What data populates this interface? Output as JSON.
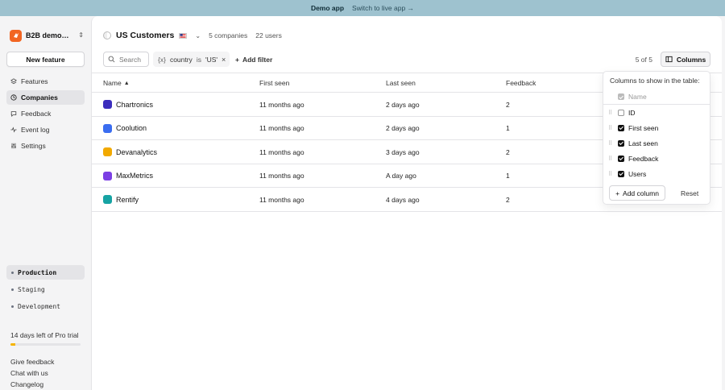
{
  "banner": {
    "demo_label": "Demo app",
    "switch_label": "Switch to live app →"
  },
  "sidebar": {
    "app_name": "B2B demo a…",
    "new_feature_label": "New feature",
    "nav": [
      {
        "label": "Features",
        "icon": "layers-icon"
      },
      {
        "label": "Companies",
        "icon": "clock-icon",
        "active": true
      },
      {
        "label": "Feedback",
        "icon": "chat-icon"
      },
      {
        "label": "Event log",
        "icon": "activity-icon"
      },
      {
        "label": "Settings",
        "icon": "sliders-icon"
      }
    ],
    "environments": [
      {
        "label": "Production",
        "active": true
      },
      {
        "label": "Staging"
      },
      {
        "label": "Development"
      }
    ],
    "trial_text": "14 days left of Pro trial",
    "trial_progress": 0.07,
    "footer_links": [
      "Give feedback",
      "Chat with us",
      "Changelog"
    ]
  },
  "main": {
    "segment_title": "US Customers",
    "companies_count": "5 companies",
    "users_count": "22 users",
    "search_placeholder": "Search",
    "filter": {
      "field": "country",
      "op": "is",
      "value": "'US'"
    },
    "add_filter_label": "Add filter",
    "result_count": "5 of 5",
    "columns_label": "Columns"
  },
  "table": {
    "headers": [
      "Name",
      "First seen",
      "Last seen",
      "Feedback"
    ],
    "rows": [
      {
        "name": "Chartronics",
        "first_seen": "11 months ago",
        "last_seen": "2 days ago",
        "feedback": "2",
        "logo_color": "#3b2dbd"
      },
      {
        "name": "Coolution",
        "first_seen": "11 months ago",
        "last_seen": "2 days ago",
        "feedback": "1",
        "logo_color": "#3a6df0"
      },
      {
        "name": "Devanalytics",
        "first_seen": "11 months ago",
        "last_seen": "3 days ago",
        "feedback": "2",
        "logo_color": "#f2a900"
      },
      {
        "name": "MaxMetrics",
        "first_seen": "11 months ago",
        "last_seen": "A day ago",
        "feedback": "1",
        "logo_color": "#7b3fe4"
      },
      {
        "name": "Rentify",
        "first_seen": "11 months ago",
        "last_seen": "4 days ago",
        "feedback": "2",
        "logo_color": "#16a3a3"
      }
    ]
  },
  "columns_popover": {
    "title": "Columns to show in the table:",
    "name_item": "Name",
    "items": [
      {
        "label": "ID",
        "checked": false
      },
      {
        "label": "First seen",
        "checked": true
      },
      {
        "label": "Last seen",
        "checked": true
      },
      {
        "label": "Feedback",
        "checked": true
      },
      {
        "label": "Users",
        "checked": true
      }
    ],
    "add_column_label": "Add column",
    "reset_label": "Reset"
  }
}
